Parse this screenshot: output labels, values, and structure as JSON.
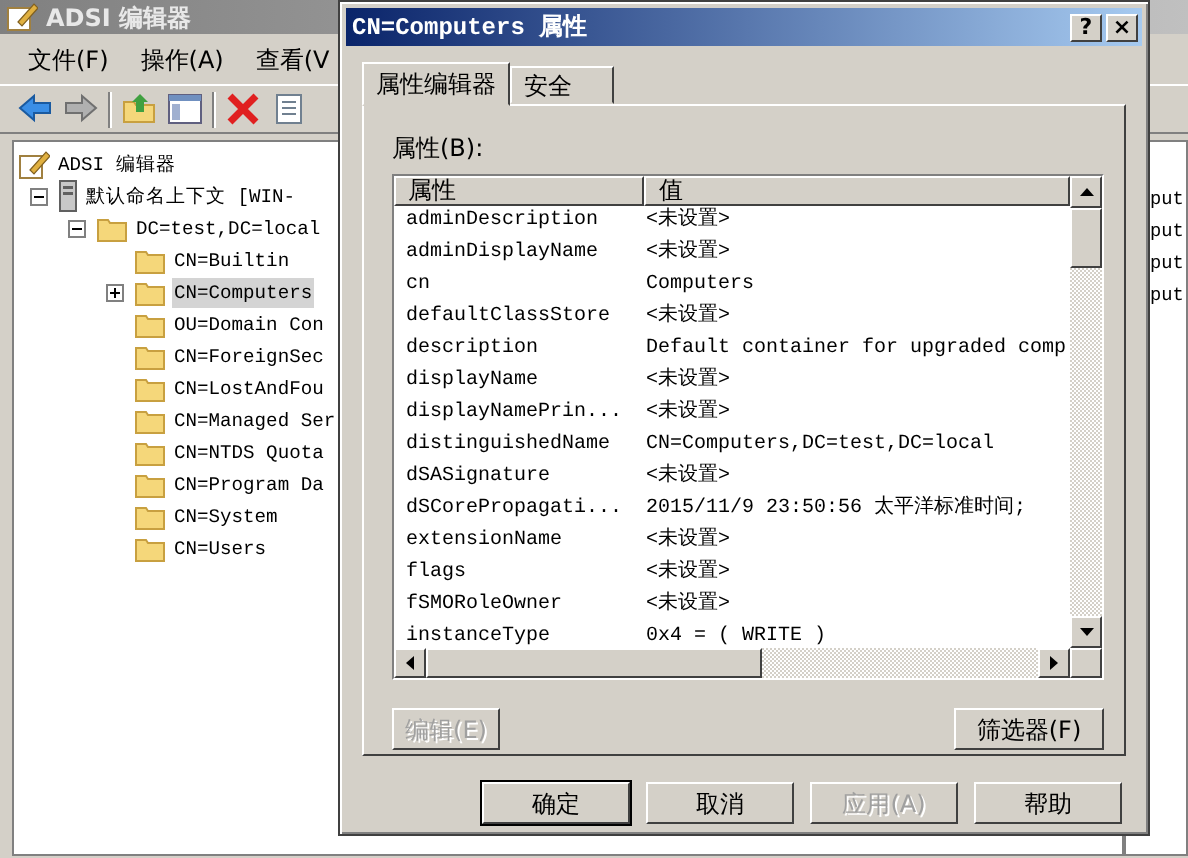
{
  "main_window": {
    "title": "ADSI 编辑器",
    "menu": [
      "文件(F)",
      "操作(A)",
      "查看(V"
    ],
    "tree": [
      {
        "label": "ADSI 编辑器",
        "kind": "editor",
        "selected": false,
        "children": [
          {
            "label": "默认命名上下文 [WIN-",
            "kind": "server",
            "expanded": true,
            "selected": false,
            "children": [
              {
                "label": "DC=test,DC=local",
                "kind": "folder",
                "expanded": true,
                "selected": false,
                "children": [
                  {
                    "label": "CN=Builtin",
                    "kind": "folder",
                    "selected": false
                  },
                  {
                    "label": "CN=Computers",
                    "kind": "folder",
                    "expanded": false,
                    "selected": true
                  },
                  {
                    "label": "OU=Domain Con",
                    "kind": "folder",
                    "selected": false
                  },
                  {
                    "label": "CN=ForeignSec",
                    "kind": "folder",
                    "selected": false
                  },
                  {
                    "label": "CN=LostAndFou",
                    "kind": "folder",
                    "selected": false
                  },
                  {
                    "label": "CN=Managed Ser",
                    "kind": "folder",
                    "selected": false
                  },
                  {
                    "label": "CN=NTDS Quota",
                    "kind": "folder",
                    "selected": false
                  },
                  {
                    "label": "CN=Program Da",
                    "kind": "folder",
                    "selected": false
                  },
                  {
                    "label": "CN=System",
                    "kind": "folder",
                    "selected": false
                  },
                  {
                    "label": "CN=Users",
                    "kind": "folder",
                    "selected": false
                  }
                ]
              }
            ]
          }
        ]
      }
    ],
    "right_pane": [
      "put",
      "put",
      "put",
      "put"
    ]
  },
  "dialog": {
    "title": "CN=Computers 属性",
    "help": "?",
    "close": "×",
    "tabs": [
      {
        "label": "属性编辑器",
        "selected": true
      },
      {
        "label": "安全",
        "selected": false
      }
    ],
    "attributes_label": "属性(B):",
    "columns": [
      "属性",
      "值"
    ],
    "rows": [
      {
        "name": "adminDescription",
        "value": "<未设置>"
      },
      {
        "name": "adminDisplayName",
        "value": "<未设置>"
      },
      {
        "name": "cn",
        "value": "Computers"
      },
      {
        "name": "defaultClassStore",
        "value": "<未设置>"
      },
      {
        "name": "description",
        "value": "Default container for upgraded comp"
      },
      {
        "name": "displayName",
        "value": "<未设置>"
      },
      {
        "name": "displayNamePrin...",
        "value": "<未设置>"
      },
      {
        "name": "distinguishedName",
        "value": "CN=Computers,DC=test,DC=local"
      },
      {
        "name": "dSASignature",
        "value": "<未设置>"
      },
      {
        "name": "dSCorePropagati...",
        "value": "2015/11/9 23:50:56 太平洋标准时间;"
      },
      {
        "name": "extensionName",
        "value": "<未设置>"
      },
      {
        "name": "flags",
        "value": "<未设置>"
      },
      {
        "name": "fSMORoleOwner",
        "value": "<未设置>"
      },
      {
        "name": "instanceType",
        "value": "0x4 = ( WRITE )"
      }
    ],
    "edit_button": {
      "label": "编辑(E)",
      "disabled": true
    },
    "filter_button": {
      "label": "筛选器(F)",
      "disabled": false
    },
    "buttons": [
      {
        "label": "确定",
        "default": true,
        "disabled": false
      },
      {
        "label": "取消",
        "default": false,
        "disabled": false
      },
      {
        "label": "应用(A)",
        "default": false,
        "disabled": true
      },
      {
        "label": "帮助",
        "default": false,
        "disabled": false
      }
    ]
  }
}
